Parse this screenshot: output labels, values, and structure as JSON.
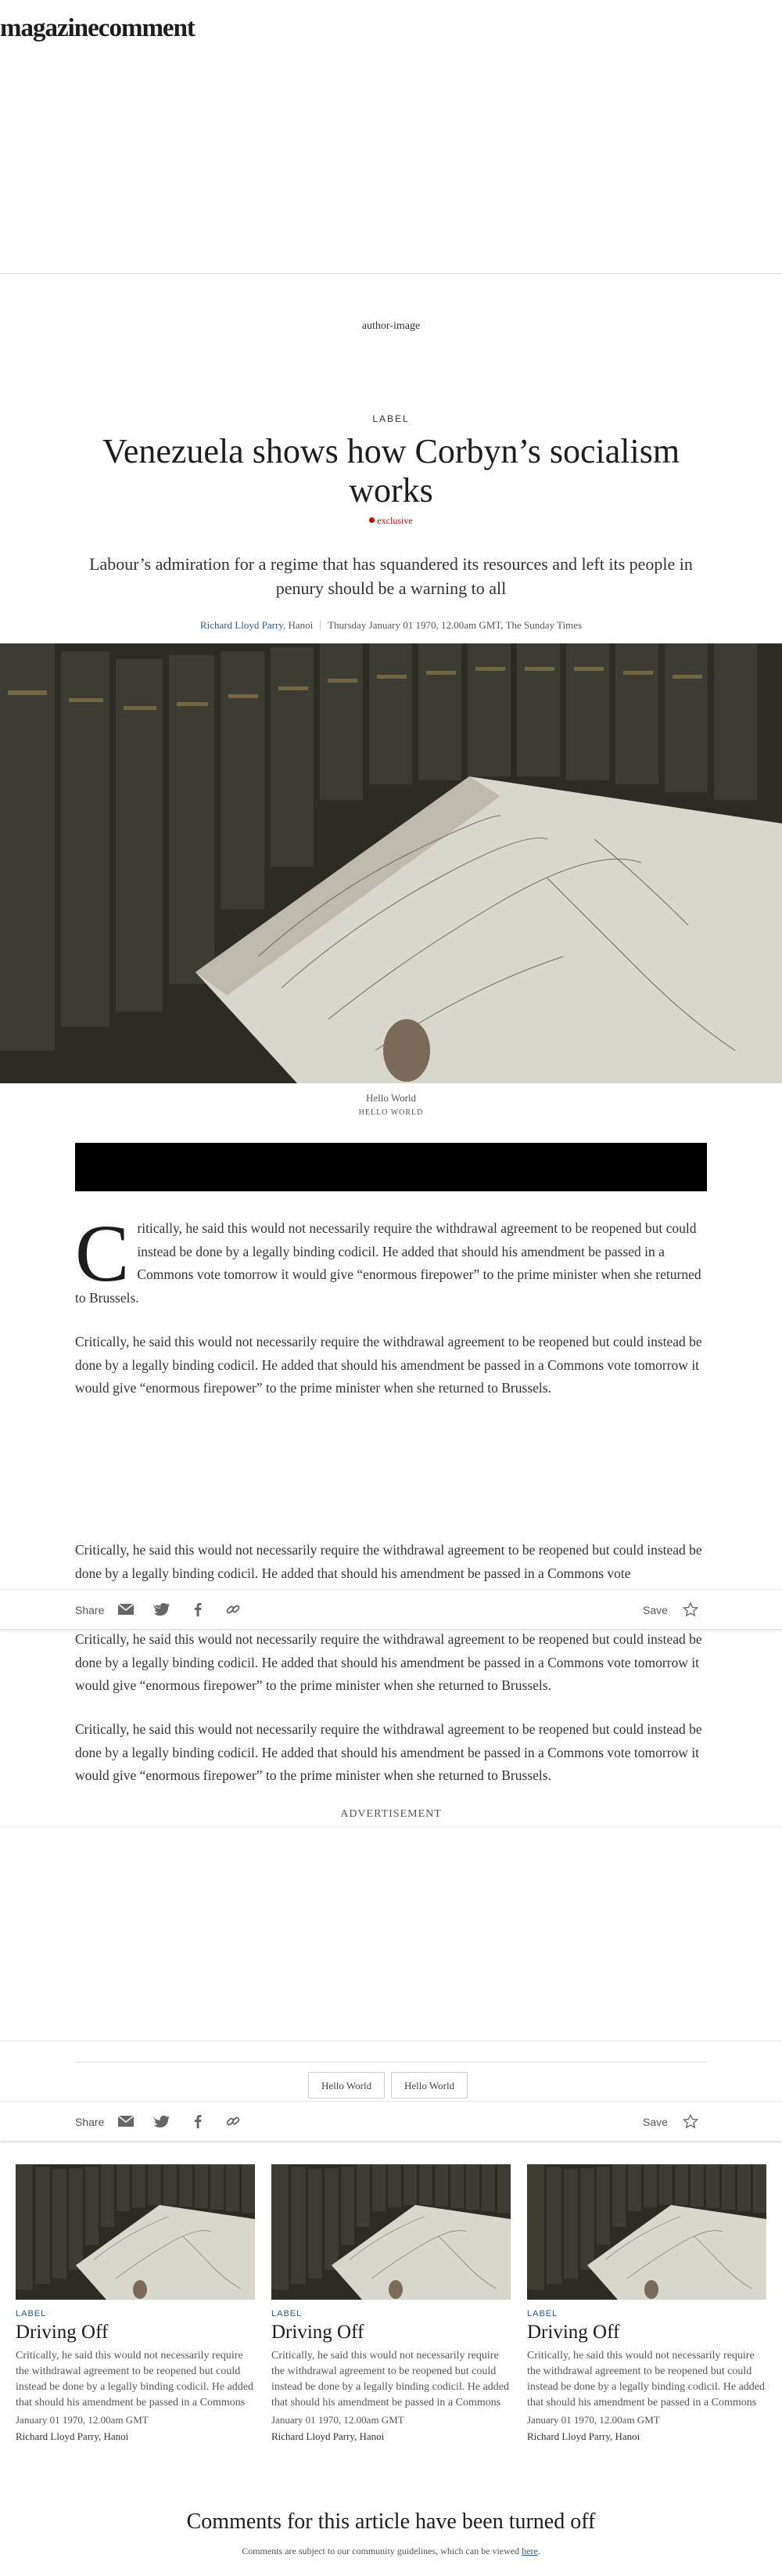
{
  "masthead": {
    "logo": "magazinecomment"
  },
  "author_image": {
    "alt": "author-image"
  },
  "article": {
    "label": "LABEL",
    "headline": "Venezuela shows how Corbyn’s socialism works",
    "flag": "exclusive",
    "standfirst": "Labour’s admiration for a regime that has squandered its resources and left its people in penury should be a warning to all",
    "author": "Richard Lloyd Parry",
    "location": ", Hanoi",
    "dateline": "Thursday January 01 1970, 12.00am GMT, The Sunday Times",
    "caption": "Hello World",
    "caption_credit": "HELLO WORLD",
    "dropcap": "C",
    "para_first": "ritically, he said this would not necessarily require the withdrawal agreement to be reopened but could instead be done by a legally binding codicil. He added that should his amendment be passed in a Commons vote tomorrow it would give “enormous firepower” to the prime minister when she returned to Brussels.",
    "para": "Critically, he said this would not necessarily require the withdrawal agreement to be reopened but could instead be done by a legally binding codicil. He added that should his amendment be passed in a Commons vote tomorrow it would give “enormous firepower” to the prime minister when she returned to Brussels.",
    "para_partial": "Critically, he said this would not necessarily require the withdrawal agreement to be reopened but could instead be done by a legally binding codicil. He added that should his amendment be passed in a Commons vote"
  },
  "share_bar": {
    "share_label": "Share",
    "save_label": "Save"
  },
  "advertisement": {
    "label": "ADVERTISEMENT"
  },
  "tags": [
    "Hello World",
    "Hello World"
  ],
  "related": [
    {
      "label": "LABEL",
      "title": "Driving Off",
      "text": "Critically, he said this would not necessarily require the withdrawal agreement to be reopened but could instead be done by a legally binding codicil. He added that should his amendment be passed in a Commons vote tomorrow it would give “enormous firepower” to the prime minister when she returned to Brussels.…",
      "date": "January 01 1970, 12.00am GMT",
      "author": "Richard Lloyd Parry, Hanoi"
    },
    {
      "label": "LABEL",
      "title": "Driving Off",
      "text": "Critically, he said this would not necessarily require the withdrawal agreement to be reopened but could instead be done by a legally binding codicil. He added that should his amendment be passed in a Commons vote tomorrow it would give “enormous firepower” to the prime minister when she returned to Brussels.…",
      "date": "January 01 1970, 12.00am GMT",
      "author": "Richard Lloyd Parry, Hanoi"
    },
    {
      "label": "LABEL",
      "title": "Driving Off",
      "text": "Critically, he said this would not necessarily require the withdrawal agreement to be reopened but could instead be done by a legally binding codicil. He added that should his amendment be passed in a Commons vote tomorrow it would give “enormous firepower” to the prime minister when she returned to Brussels.…",
      "date": "January 01 1970, 12.00am GMT",
      "author": "Richard Lloyd Parry, Hanoi"
    }
  ],
  "comments": {
    "title": "Comments for this article have been turned off",
    "note": "Comments are subject to our community guidelines, which can be viewed ",
    "link": "here",
    "note_end": "."
  }
}
